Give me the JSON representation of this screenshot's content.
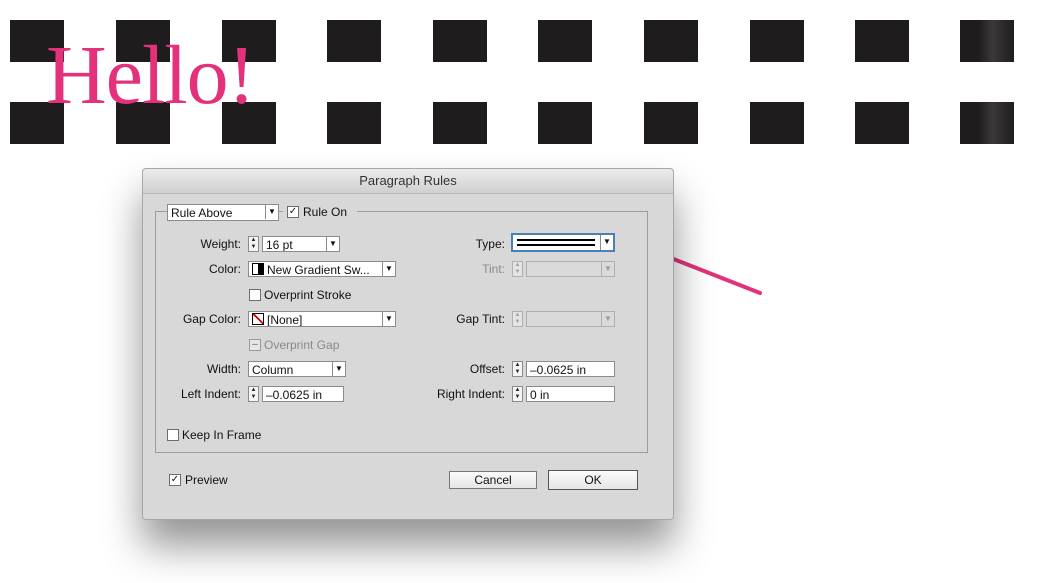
{
  "document": {
    "text": "Hello!",
    "text_color": "#e3327b"
  },
  "dialog": {
    "title": "Paragraph Rules",
    "rule_select": "Rule Above",
    "rule_on_label": "Rule On",
    "rule_on_checked": true,
    "weight": {
      "label": "Weight:",
      "value": "16 pt"
    },
    "type": {
      "label": "Type:",
      "value_icon": "thick-thin-double-line"
    },
    "color": {
      "label": "Color:",
      "value": "New Gradient Sw..."
    },
    "tint": {
      "label": "Tint:",
      "value": ""
    },
    "overprint_stroke": {
      "label": "Overprint Stroke",
      "checked": false
    },
    "gap_color": {
      "label": "Gap Color:",
      "value": "[None]"
    },
    "gap_tint": {
      "label": "Gap Tint:",
      "value": ""
    },
    "overprint_gap": {
      "label": "Overprint Gap",
      "state": "mixed"
    },
    "width": {
      "label": "Width:",
      "value": "Column"
    },
    "offset": {
      "label": "Offset:",
      "value": "–0.0625 in"
    },
    "left_indent": {
      "label": "Left Indent:",
      "value": "–0.0625 in"
    },
    "right_indent": {
      "label": "Right Indent:",
      "value": "0 in"
    },
    "keep_in_frame": {
      "label": "Keep In Frame",
      "checked": false
    },
    "preview": {
      "label": "Preview",
      "checked": true
    },
    "cancel_label": "Cancel",
    "ok_label": "OK"
  },
  "annotation": {
    "arrow_color": "#e3327b",
    "icon": "pointer-arrow"
  }
}
